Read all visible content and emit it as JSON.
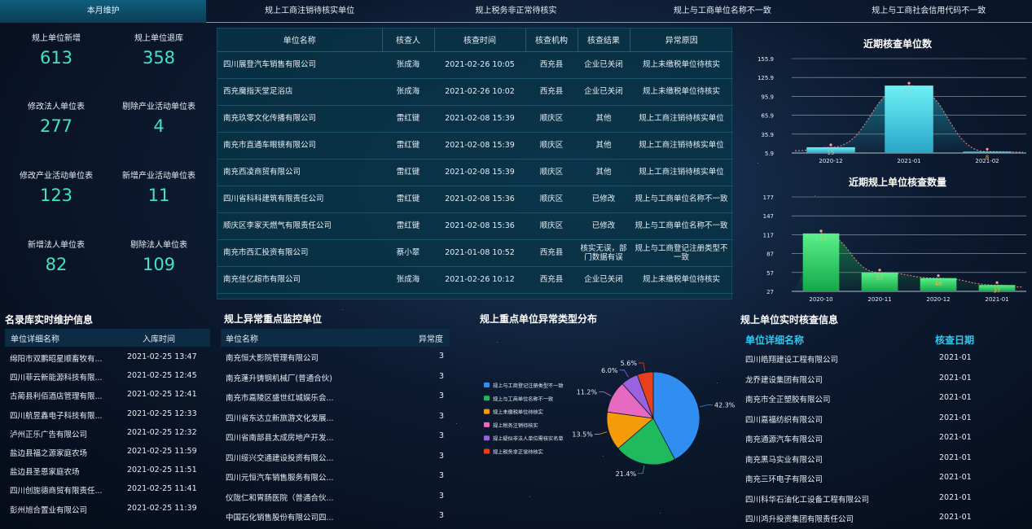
{
  "tabs": [
    "本月维护",
    "规上工商注销待核实单位",
    "规上税务非正常待核实",
    "规上与工商单位名称不一致",
    "规上与工商社会信用代码不一致"
  ],
  "stats": [
    {
      "label": "规上单位新增",
      "value": "613"
    },
    {
      "label": "规上单位退库",
      "value": "358"
    },
    {
      "label": "修改法人单位表",
      "value": "277"
    },
    {
      "label": "剔除产业活动单位表",
      "value": "4"
    },
    {
      "label": "修改产业活动单位表",
      "value": "123"
    },
    {
      "label": "新增产业活动单位表",
      "value": "11"
    },
    {
      "label": "新增法人单位表",
      "value": "82"
    },
    {
      "label": "剔除法人单位表",
      "value": "109"
    }
  ],
  "main_table": {
    "headers": [
      "单位名称",
      "核查人",
      "核查时间",
      "核查机构",
      "核查结果",
      "异常原因"
    ],
    "rows": [
      [
        "四川展登汽车销售有限公司",
        "张成海",
        "2021-02-26 10:05",
        "西充县",
        "企业已关闭",
        "规上未缴税单位待核实"
      ],
      [
        "西充魔指天堂足浴店",
        "张成海",
        "2021-02-26 10:02",
        "西充县",
        "企业已关闭",
        "规上未缴税单位待核实"
      ],
      [
        "南充玖零文化传播有限公司",
        "雷红键",
        "2021-02-08 15:39",
        "顺庆区",
        "其他",
        "规上工商注销待核实单位"
      ],
      [
        "南充市直通车眼镜有限公司",
        "雷红键",
        "2021-02-08 15:39",
        "顺庆区",
        "其他",
        "规上工商注销待核实单位"
      ],
      [
        "南充西凌商贸有限公司",
        "雷红键",
        "2021-02-08 15:39",
        "顺庆区",
        "其他",
        "规上工商注销待核实单位"
      ],
      [
        "四川省科科建筑有限责任公司",
        "雷红键",
        "2021-02-08 15:36",
        "顺庆区",
        "已修改",
        "规上与工商单位名称不一致"
      ],
      [
        "顺庆区李家天燃气有限责任公司",
        "雷红键",
        "2021-02-08 15:36",
        "顺庆区",
        "已修改",
        "规上与工商单位名称不一致"
      ],
      [
        "南充市西汇投资有限公司",
        "蔡小翠",
        "2021-01-08 10:52",
        "西充县",
        "核实无误，部门数据有误",
        "规上与工商登记注册类型不一致"
      ],
      [
        "南充佳亿超市有限公司",
        "张成海",
        "2021-02-26 10:12",
        "西充县",
        "企业已关闭",
        "规上未缴税单位待核实"
      ]
    ]
  },
  "charts": {
    "recent_check": {
      "title": "近期核查单位数",
      "chart_data": {
        "type": "bar",
        "categories": [
          "2020-12",
          "2021-01",
          "2021-02"
        ],
        "values": [
          15,
          113,
          8
        ],
        "yticks": [
          "5.9",
          "35.9",
          "65.9",
          "95.9",
          "125.9",
          "155.9"
        ],
        "ylim": [
          5.9,
          155.9
        ]
      }
    },
    "recent_gs_check": {
      "title": "近期规上单位核查数量",
      "chart_data": {
        "type": "bar",
        "categories": [
          "2020-10",
          "2020-11",
          "2020-12",
          "2021-01"
        ],
        "values": [
          119,
          57,
          48,
          37
        ],
        "yticks": [
          "27",
          "57",
          "87",
          "117",
          "147",
          "177"
        ],
        "ylim": [
          27,
          177
        ]
      }
    },
    "pie": {
      "title": "规上重点单位异常类型分布",
      "chart_data": {
        "type": "pie",
        "labels": [
          "规上与工商登记注册类型不一致",
          "规上与工商单位名称不一致",
          "规上未缴税单位待核实",
          "规上税务注销待核实",
          "规上疑似非法人单位需核实名单",
          "规上税务非正常待核实"
        ],
        "values": [
          42.3,
          21.4,
          13.5,
          11.2,
          6.0,
          5.6
        ],
        "value_labels": [
          "42.3%",
          "21.4%",
          "13.5%",
          "11.2%",
          "6.0%",
          "5.6%"
        ],
        "colors": [
          "#2f8ef0",
          "#1fba5e",
          "#f59b0a",
          "#e66bc0",
          "#9a61e0",
          "#e8401c"
        ]
      }
    }
  },
  "sections": {
    "realtime_maintain": "名录库实时维护信息",
    "abnormal_monitor": "规上异常重点监控单位",
    "realtime_check": "规上单位实时核查信息"
  },
  "maintain_list": {
    "headers": [
      "单位详细名称",
      "入库时间"
    ],
    "rows": [
      [
        "绵阳市双鹏昭星顺畜牧有...",
        "2021-02-25 13:47"
      ],
      [
        "四川菲云新能源科技有限...",
        "2021-02-25 12:45"
      ],
      [
        "古蔺县利佰酒店管理有限...",
        "2021-02-25 12:41"
      ],
      [
        "四川航昱鑫电子科技有限...",
        "2021-02-25 12:33"
      ],
      [
        "泸州正乐广告有限公司",
        "2021-02-25 12:32"
      ],
      [
        "盐边县福之源家庭农场",
        "2021-02-25 11:59"
      ],
      [
        "盐边县圣恩家庭农场",
        "2021-02-25 11:51"
      ],
      [
        "四川创旎德商贸有限责任...",
        "2021-02-25 11:41"
      ],
      [
        "彭州旭合置业有限公司",
        "2021-02-25 11:39"
      ]
    ]
  },
  "monitor_list": {
    "headers": [
      "单位名称",
      "异常度"
    ],
    "rows": [
      [
        "南充恒大影院管理有限公司",
        "3"
      ],
      [
        "南充蓬升铸钢机械厂(普通合伙)",
        "3"
      ],
      [
        "南充市嘉陵区盛世红城娱乐会...",
        "3"
      ],
      [
        "四川省东达立新旅游文化发展...",
        "3"
      ],
      [
        "四川省南部县太成房地产开发...",
        "3"
      ],
      [
        "四川绥兴交通建设投资有限公...",
        "3"
      ],
      [
        "四川元恒汽车销售服务有限公...",
        "3"
      ],
      [
        "仪陇仁和胃肠医院（普通合伙...",
        "3"
      ],
      [
        "中国石化销售股份有限公司四...",
        "3"
      ]
    ]
  },
  "check_list": {
    "headers": [
      "单位详细名称",
      "核查日期"
    ],
    "rows": [
      [
        "四川皓翔建设工程有限公司",
        "2021-01"
      ],
      [
        "龙乔建设集团有限公司",
        "2021-01"
      ],
      [
        "南充市全正塑胶有限公司",
        "2021-01"
      ],
      [
        "四川嘉福纺织有限公司",
        "2021-01"
      ],
      [
        "南充通源汽车有限公司",
        "2021-01"
      ],
      [
        "南充黑马实业有限公司",
        "2021-01"
      ],
      [
        "南充三环电子有限公司",
        "2021-01"
      ],
      [
        "四川科华石油化工设备工程有限公司",
        "2021-01"
      ],
      [
        "四川鸿升投资集团有限责任公司",
        "2021-01"
      ]
    ]
  }
}
